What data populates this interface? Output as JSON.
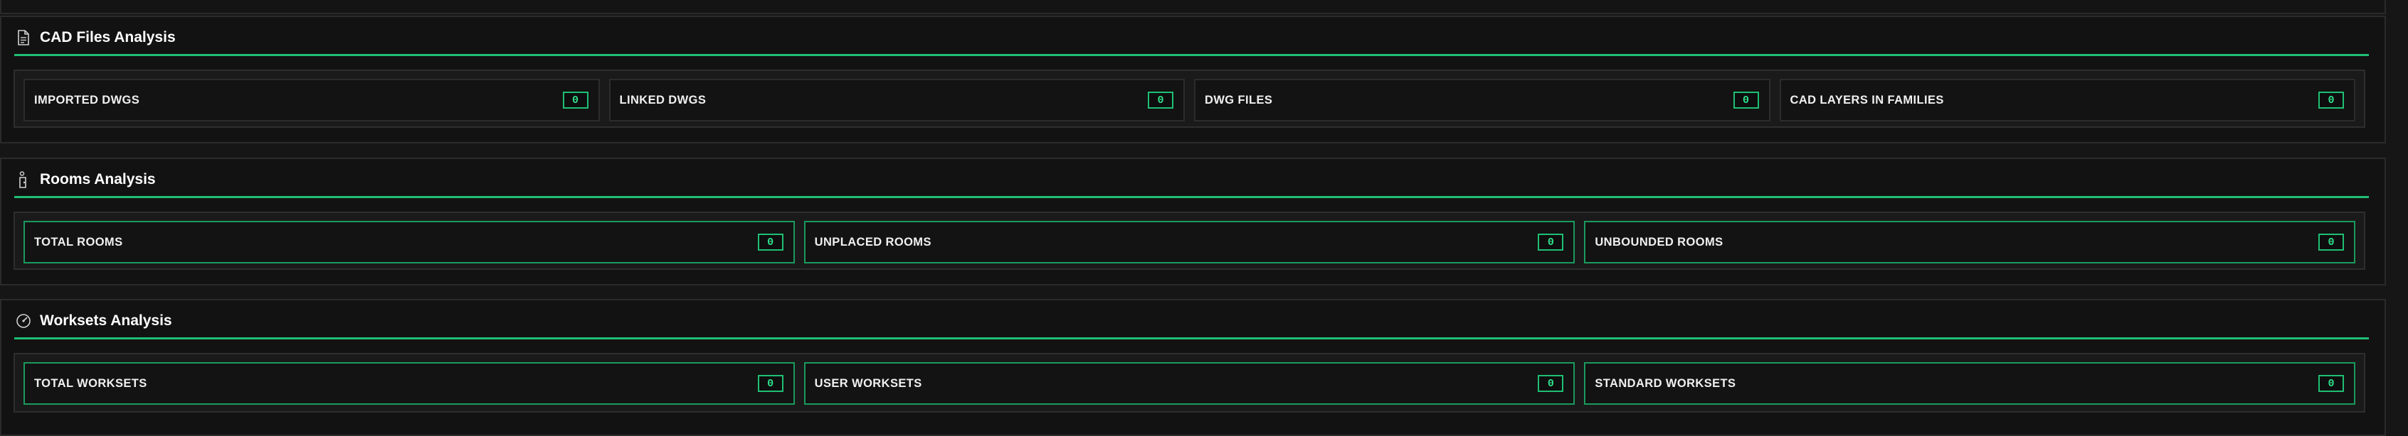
{
  "colors": {
    "accent": "#1fbf74",
    "value_text": "#2ee08a",
    "background": "#121212"
  },
  "sections": [
    {
      "title": "CAD Files Analysis",
      "icon": "file-icon",
      "cards": [
        {
          "label": "IMPORTED DWGS",
          "value": "0"
        },
        {
          "label": "LINKED DWGS",
          "value": "0"
        },
        {
          "label": "DWG FILES",
          "value": "0"
        },
        {
          "label": "CAD LAYERS IN FAMILIES",
          "value": "0"
        }
      ]
    },
    {
      "title": "Rooms Analysis",
      "icon": "door-icon",
      "cards": [
        {
          "label": "TOTAL ROOMS",
          "value": "0"
        },
        {
          "label": "UNPLACED ROOMS",
          "value": "0"
        },
        {
          "label": "UNBOUNDED ROOMS",
          "value": "0"
        }
      ]
    },
    {
      "title": "Worksets Analysis",
      "icon": "gauge-icon",
      "cards": [
        {
          "label": "TOTAL WORKSETS",
          "value": "0"
        },
        {
          "label": "USER WORKSETS",
          "value": "0"
        },
        {
          "label": "STANDARD WORKSETS",
          "value": "0"
        }
      ]
    }
  ]
}
